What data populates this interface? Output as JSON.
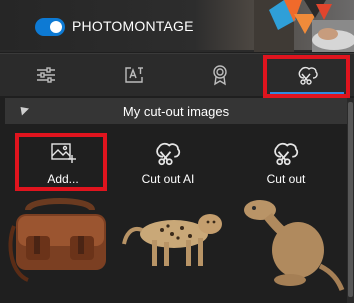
{
  "header": {
    "brand": "PHOTOMONTAGE",
    "toggle_on": true,
    "accent_color": "#0d7ad4"
  },
  "tabs": [
    {
      "name": "adjustments",
      "icon": "sliders-icon",
      "active": false
    },
    {
      "name": "text",
      "icon": "text-frame-icon",
      "active": false
    },
    {
      "name": "badges",
      "icon": "badge-icon",
      "active": false
    },
    {
      "name": "cutouts",
      "icon": "cutout-scissors-icon",
      "active": true
    }
  ],
  "section": {
    "title": "My cut-out images",
    "expanded": true
  },
  "actions": {
    "add_label": "Add...",
    "cutout_ai_label": "Cut out AI",
    "cutout_label": "Cut out"
  },
  "images": [
    {
      "icon": "leather-bag-image"
    },
    {
      "icon": "cheetah-cub-image"
    },
    {
      "icon": "meerkat-image"
    }
  ],
  "highlight_color": "#e0141e"
}
